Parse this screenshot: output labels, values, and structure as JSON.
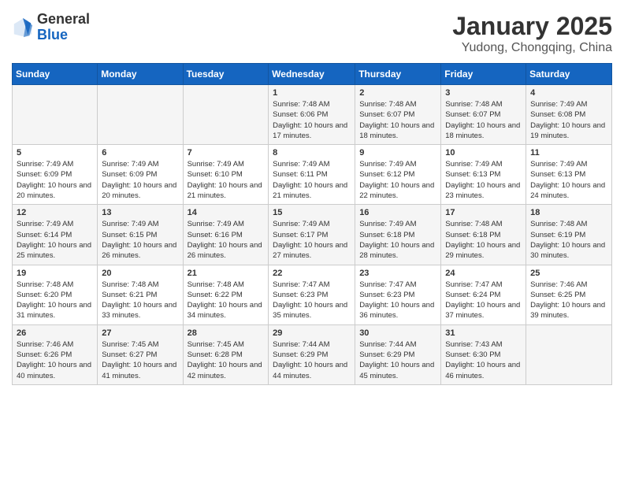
{
  "header": {
    "logo_general": "General",
    "logo_blue": "Blue",
    "title": "January 2025",
    "subtitle": "Yudong, Chongqing, China"
  },
  "weekdays": [
    "Sunday",
    "Monday",
    "Tuesday",
    "Wednesday",
    "Thursday",
    "Friday",
    "Saturday"
  ],
  "weeks": [
    [
      {
        "day": "",
        "info": ""
      },
      {
        "day": "",
        "info": ""
      },
      {
        "day": "",
        "info": ""
      },
      {
        "day": "1",
        "info": "Sunrise: 7:48 AM\nSunset: 6:06 PM\nDaylight: 10 hours and 17 minutes."
      },
      {
        "day": "2",
        "info": "Sunrise: 7:48 AM\nSunset: 6:07 PM\nDaylight: 10 hours and 18 minutes."
      },
      {
        "day": "3",
        "info": "Sunrise: 7:48 AM\nSunset: 6:07 PM\nDaylight: 10 hours and 18 minutes."
      },
      {
        "day": "4",
        "info": "Sunrise: 7:49 AM\nSunset: 6:08 PM\nDaylight: 10 hours and 19 minutes."
      }
    ],
    [
      {
        "day": "5",
        "info": "Sunrise: 7:49 AM\nSunset: 6:09 PM\nDaylight: 10 hours and 20 minutes."
      },
      {
        "day": "6",
        "info": "Sunrise: 7:49 AM\nSunset: 6:09 PM\nDaylight: 10 hours and 20 minutes."
      },
      {
        "day": "7",
        "info": "Sunrise: 7:49 AM\nSunset: 6:10 PM\nDaylight: 10 hours and 21 minutes."
      },
      {
        "day": "8",
        "info": "Sunrise: 7:49 AM\nSunset: 6:11 PM\nDaylight: 10 hours and 21 minutes."
      },
      {
        "day": "9",
        "info": "Sunrise: 7:49 AM\nSunset: 6:12 PM\nDaylight: 10 hours and 22 minutes."
      },
      {
        "day": "10",
        "info": "Sunrise: 7:49 AM\nSunset: 6:13 PM\nDaylight: 10 hours and 23 minutes."
      },
      {
        "day": "11",
        "info": "Sunrise: 7:49 AM\nSunset: 6:13 PM\nDaylight: 10 hours and 24 minutes."
      }
    ],
    [
      {
        "day": "12",
        "info": "Sunrise: 7:49 AM\nSunset: 6:14 PM\nDaylight: 10 hours and 25 minutes."
      },
      {
        "day": "13",
        "info": "Sunrise: 7:49 AM\nSunset: 6:15 PM\nDaylight: 10 hours and 26 minutes."
      },
      {
        "day": "14",
        "info": "Sunrise: 7:49 AM\nSunset: 6:16 PM\nDaylight: 10 hours and 26 minutes."
      },
      {
        "day": "15",
        "info": "Sunrise: 7:49 AM\nSunset: 6:17 PM\nDaylight: 10 hours and 27 minutes."
      },
      {
        "day": "16",
        "info": "Sunrise: 7:49 AM\nSunset: 6:18 PM\nDaylight: 10 hours and 28 minutes."
      },
      {
        "day": "17",
        "info": "Sunrise: 7:48 AM\nSunset: 6:18 PM\nDaylight: 10 hours and 29 minutes."
      },
      {
        "day": "18",
        "info": "Sunrise: 7:48 AM\nSunset: 6:19 PM\nDaylight: 10 hours and 30 minutes."
      }
    ],
    [
      {
        "day": "19",
        "info": "Sunrise: 7:48 AM\nSunset: 6:20 PM\nDaylight: 10 hours and 31 minutes."
      },
      {
        "day": "20",
        "info": "Sunrise: 7:48 AM\nSunset: 6:21 PM\nDaylight: 10 hours and 33 minutes."
      },
      {
        "day": "21",
        "info": "Sunrise: 7:48 AM\nSunset: 6:22 PM\nDaylight: 10 hours and 34 minutes."
      },
      {
        "day": "22",
        "info": "Sunrise: 7:47 AM\nSunset: 6:23 PM\nDaylight: 10 hours and 35 minutes."
      },
      {
        "day": "23",
        "info": "Sunrise: 7:47 AM\nSunset: 6:23 PM\nDaylight: 10 hours and 36 minutes."
      },
      {
        "day": "24",
        "info": "Sunrise: 7:47 AM\nSunset: 6:24 PM\nDaylight: 10 hours and 37 minutes."
      },
      {
        "day": "25",
        "info": "Sunrise: 7:46 AM\nSunset: 6:25 PM\nDaylight: 10 hours and 39 minutes."
      }
    ],
    [
      {
        "day": "26",
        "info": "Sunrise: 7:46 AM\nSunset: 6:26 PM\nDaylight: 10 hours and 40 minutes."
      },
      {
        "day": "27",
        "info": "Sunrise: 7:45 AM\nSunset: 6:27 PM\nDaylight: 10 hours and 41 minutes."
      },
      {
        "day": "28",
        "info": "Sunrise: 7:45 AM\nSunset: 6:28 PM\nDaylight: 10 hours and 42 minutes."
      },
      {
        "day": "29",
        "info": "Sunrise: 7:44 AM\nSunset: 6:29 PM\nDaylight: 10 hours and 44 minutes."
      },
      {
        "day": "30",
        "info": "Sunrise: 7:44 AM\nSunset: 6:29 PM\nDaylight: 10 hours and 45 minutes."
      },
      {
        "day": "31",
        "info": "Sunrise: 7:43 AM\nSunset: 6:30 PM\nDaylight: 10 hours and 46 minutes."
      },
      {
        "day": "",
        "info": ""
      }
    ]
  ]
}
